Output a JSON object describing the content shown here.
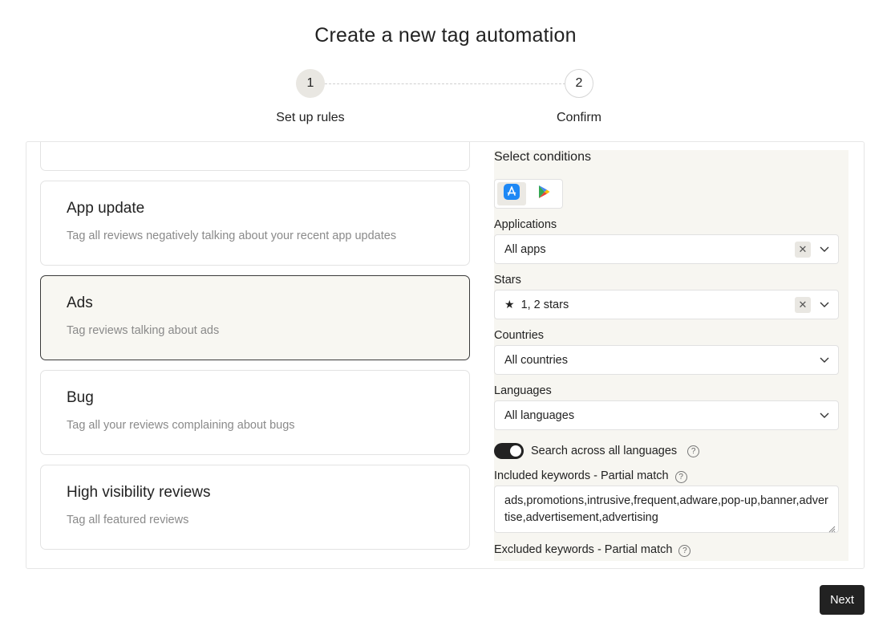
{
  "header": {
    "title": "Create a new tag automation"
  },
  "stepper": {
    "steps": [
      {
        "number": "1",
        "label": "Set up rules"
      },
      {
        "number": "2",
        "label": "Confirm"
      }
    ]
  },
  "cards": [
    {
      "title": "App update",
      "desc": "Tag all reviews negatively talking about your recent app updates"
    },
    {
      "title": "Ads",
      "desc": "Tag reviews talking about ads"
    },
    {
      "title": "Bug",
      "desc": "Tag all your reviews complaining about bugs"
    },
    {
      "title": "High visibility reviews",
      "desc": "Tag all featured reviews"
    }
  ],
  "conditions": {
    "title": "Select conditions",
    "stores": [
      "app-store-icon",
      "google-play-icon"
    ],
    "applications": {
      "label": "Applications",
      "value": "All apps"
    },
    "stars": {
      "label": "Stars",
      "value": "1, 2 stars"
    },
    "countries": {
      "label": "Countries",
      "value": "All countries"
    },
    "languages": {
      "label": "Languages",
      "value": "All languages"
    },
    "search_toggle": {
      "label": "Search across all languages",
      "on": true
    },
    "included": {
      "label": "Included keywords - Partial match",
      "value": "ads,promotions,intrusive,frequent,adware,pop-up,banner,advertise,advertisement,advertising"
    },
    "excluded": {
      "label": "Excluded keywords - Partial match"
    }
  },
  "footer": {
    "next_label": "Next"
  },
  "colors": {
    "accent": "#222222",
    "selected_bg": "#f8f7f2",
    "panel_bg": "#f7f6f1",
    "app_store_blue": "#1e88f5"
  }
}
